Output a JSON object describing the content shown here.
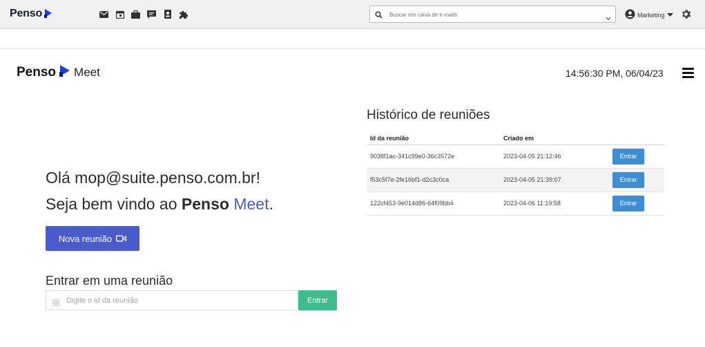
{
  "topbar": {
    "brand": "Penso",
    "apps": [
      "mail-icon",
      "calendar-icon",
      "briefcase-icon",
      "chat-icon",
      "contacts-icon",
      "extensions-icon"
    ],
    "search": {
      "placeholder": "Buscar em caixa de e-mails",
      "value": ""
    },
    "user": {
      "label": "Marketing"
    }
  },
  "meet_header": {
    "brand": "Penso",
    "product": "Meet",
    "clock": "14:56:30 PM, 06/04/23"
  },
  "greeting": {
    "line1": "Olá mop@suite.penso.com.br!",
    "line2_prefix": "Seja bem vindo ao ",
    "line2_brand": "Penso",
    "line2_space": " ",
    "line2_product": "Meet",
    "line2_suffix": "."
  },
  "new_meeting": {
    "label": "Nova reunião"
  },
  "join": {
    "title": "Entrar em uma reunião",
    "placeholder": "Digite o id da reunião",
    "button": "Entrar"
  },
  "history": {
    "title": "Histórico de reuniões",
    "columns": [
      "Id da reunião",
      "Criado em"
    ],
    "rows": [
      {
        "id": "9038f1ac-341c99e0-36c3572e",
        "created": "2023-04-05 21:12:46",
        "action": "Entrar"
      },
      {
        "id": "f53c5f7e-2fe16bf1-d2c3c0ca",
        "created": "2023-04-05 21:39:07",
        "action": "Entrar"
      },
      {
        "id": "122cf453-9e014d86-64f09bb4",
        "created": "2023-04-06 11:19:58",
        "action": "Entrar"
      }
    ]
  },
  "colors": {
    "primary": "#4a5bcc",
    "success": "#3dbd8b",
    "info": "#3c8fd6",
    "logo_blue": "#1f3fe0"
  }
}
